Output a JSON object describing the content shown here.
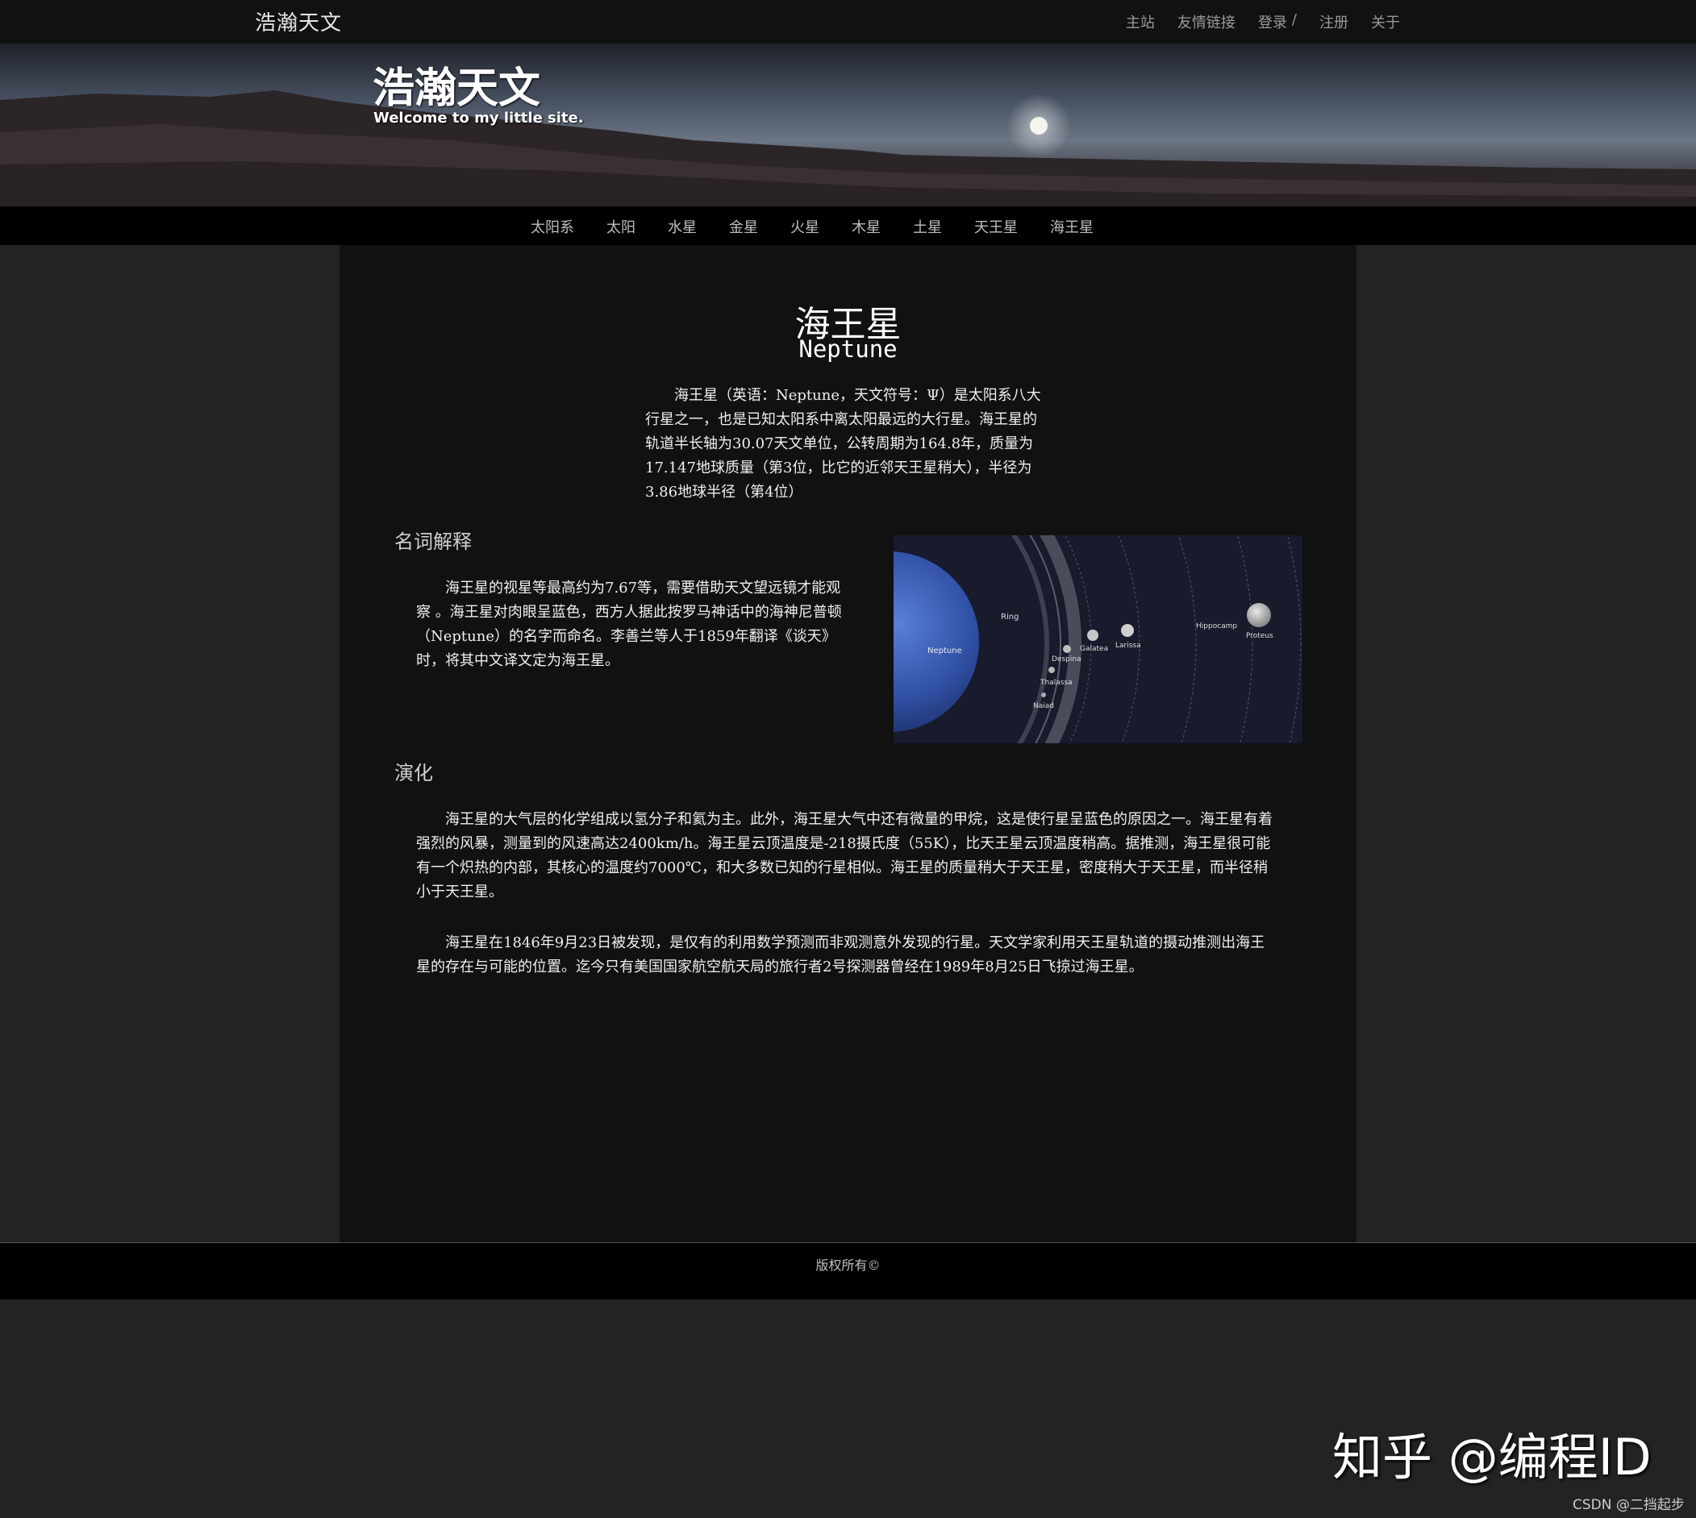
{
  "topbar": {
    "brand": "浩瀚天文",
    "links": {
      "home": "主站",
      "friends": "友情链接",
      "login": "登录",
      "separator": "/",
      "register": "注册",
      "about": "关于"
    }
  },
  "banner": {
    "title": "浩瀚天文",
    "subtitle": "Welcome to my little site."
  },
  "planet_nav": [
    "太阳系",
    "太阳",
    "水星",
    "金星",
    "火星",
    "木星",
    "土星",
    "天王星",
    "海王星"
  ],
  "article": {
    "title": "海王星",
    "title_en": "Neptune",
    "intro": "海王星（英语：Neptune，天文符号：Ψ）是太阳系八大行星之一，也是已知太阳系中离太阳最远的大行星。海王星的轨道半长轴为30.07天文单位，公转周期为164.8年，质量为17.147地球质量（第3位，比它的近邻天王星稍大），半径为3.86地球半径（第4位）",
    "section1_title": "名词解释",
    "section1_text": "海王星的视星等最高约为7.67等，需要借助天文望远镜才能观察 。海王星对肉眼呈蓝色，西方人据此按罗马神话中的海神尼普顿（Neptune）的名字而命名。李善兰等人于1859年翻译《谈天》时，将其中文译文定为海王星。",
    "section2_title": "演化",
    "section2_text1": "海王星的大气层的化学组成以氢分子和氦为主。此外，海王星大气中还有微量的甲烷，这是使行星呈蓝色的原因之一。海王星有着强烈的风暴，测量到的风速高达2400km/h。海王星云顶温度是-218摄氏度（55K），比天王星云顶温度稍高。据推测，海王星很可能有一个炽热的内部，其核心的温度约7000℃，和大多数已知的行星相似。海王星的质量稍大于天王星，密度稍大于天王星，而半径稍小于天王星。",
    "section2_text2": "海王星在1846年9月23日被发现，是仅有的利用数学预测而非观测意外发现的行星。天文学家利用天王星轨道的摄动推测出海王星的存在与可能的位置。迄今只有美国国家航空航天局的旅行者2号探测器曾经在1989年8月25日飞掠过海王星。"
  },
  "diagram_labels": {
    "neptune": "Neptune",
    "ring": "Ring",
    "galatea": "Galatea",
    "larissa": "Larissa",
    "despina": "Despina",
    "thalassa": "Thalassa",
    "naiad": "Naiad",
    "hippocamp": "Hippocamp",
    "proteus": "Proteus"
  },
  "footer": {
    "text": "版权所有©"
  },
  "watermark": {
    "main": "知乎 @编程ID",
    "small": "CSDN @二挡起步"
  }
}
